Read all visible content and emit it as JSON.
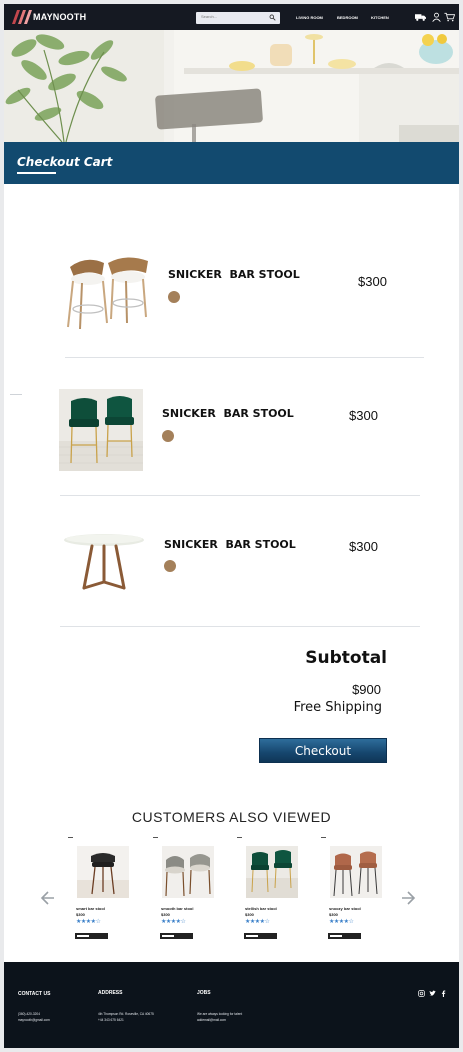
{
  "header": {
    "brand": "MAYNOOTH",
    "search_placeholder": "Search...",
    "nav": [
      "LIVING ROOM",
      "BEDROOM",
      "KITCHEN"
    ]
  },
  "banner": {
    "title": "Checkout Cart"
  },
  "cart": {
    "items": [
      {
        "name": "SNICKER  BAR STOOL",
        "price": "$300",
        "image": "wood-bar-stool-pair"
      },
      {
        "name": "SNICKER  BAR STOOL",
        "price": "$300",
        "image": "green-velvet-bar-stool-pair"
      },
      {
        "name": "SNICKER  BAR STOOL",
        "price": "$300",
        "image": "marble-round-table"
      }
    ],
    "swatch_color": "#a4805a",
    "subtotal_label": "Subtotal",
    "subtotal_value": "$900",
    "shipping": "Free Shipping",
    "checkout_label": "Checkout"
  },
  "also_viewed": {
    "title": "CUSTOMERS ALSO VIEWED",
    "products": [
      {
        "name": "smart bar stool",
        "price": "$300",
        "rating": "★★★★☆"
      },
      {
        "name": "smooth bar stool",
        "price": "$300",
        "rating": "★★★★☆"
      },
      {
        "name": "stellish bar stool",
        "price": "$300",
        "rating": "★★★★☆"
      },
      {
        "name": "snoozy bar stool",
        "price": "$300",
        "rating": "★★★★☆"
      }
    ]
  },
  "footer": {
    "contact_heading": "CONTACT US",
    "contact_phone": "(360)-420-3204",
    "contact_email": "maynooth@gmail.com",
    "address_heading": "ADDRESS",
    "address_line1": "4th Thompson Rd. Roseville, CA 40675",
    "address_line2": "+44 343 675 6421",
    "jobs_heading": "JOBS",
    "jobs_line1": "We are always looking for talent",
    "jobs_line2": "addemail@mail.com"
  },
  "colors": {
    "nav_bg": "#151922",
    "banner_bg": "#124a6f",
    "footer_bg": "#0c131b",
    "accent": "#16466e"
  }
}
